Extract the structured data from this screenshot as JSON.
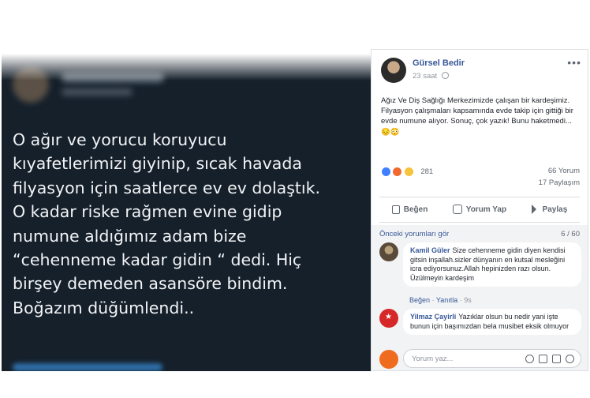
{
  "tweet": {
    "text": "O ağır ve yorucu koruyucu\nkıyafetlerimizi giyinip, sıcak havada\nfilyasyon için saatlerce ev ev dolaştık.\nO kadar riske rağmen evine gidip\nnumune aldığımız adam bize\n“cehenneme kadar gidin “ dedi. Hiç\nbirşey demeden asansöre bindim.\nBoğazım düğümlendi.."
  },
  "post": {
    "author": "Gürsel Bedir",
    "time": "23 saat",
    "more_icon": "ellipsis-icon",
    "text": "Ağız Ve Diş Sağlığı Merkezimizde çalışan bir kardeşimiz. Filyasyon çalışmaları kapsamında evde takip için gittiği bir evde numune alıyor. Sonuç, çok yazık! Bunu haketmedi... 😔😳",
    "reactions_count": "281",
    "comments_count": "66 Yorum",
    "shares_count": "17 Paylaşım",
    "actions": {
      "like": "Beğen",
      "comment": "Yorum Yap",
      "share": "Paylaş"
    },
    "prev_comments": "Önceki yorumları gör",
    "comment_paging": "6 / 60",
    "comments": [
      {
        "name": "Kamil Güler",
        "text": "Size cehenneme gidin diyen kendisi gitsin inşallah.sizler dünyanın en kutsal mesleğini icra ediyorsunuz.Allah hepinizden razı olsun. Üzülmeyin kardeşim",
        "like": "Beğen",
        "reply": "Yanıtla",
        "time": "9s"
      },
      {
        "name": "Yilmaz Çayirli",
        "text": "Yazıklar olsun bu nedir yani işte bunun için başımızdan bela musibet eksik olmuyor"
      }
    ],
    "write_placeholder": "Yorum yaz..."
  }
}
